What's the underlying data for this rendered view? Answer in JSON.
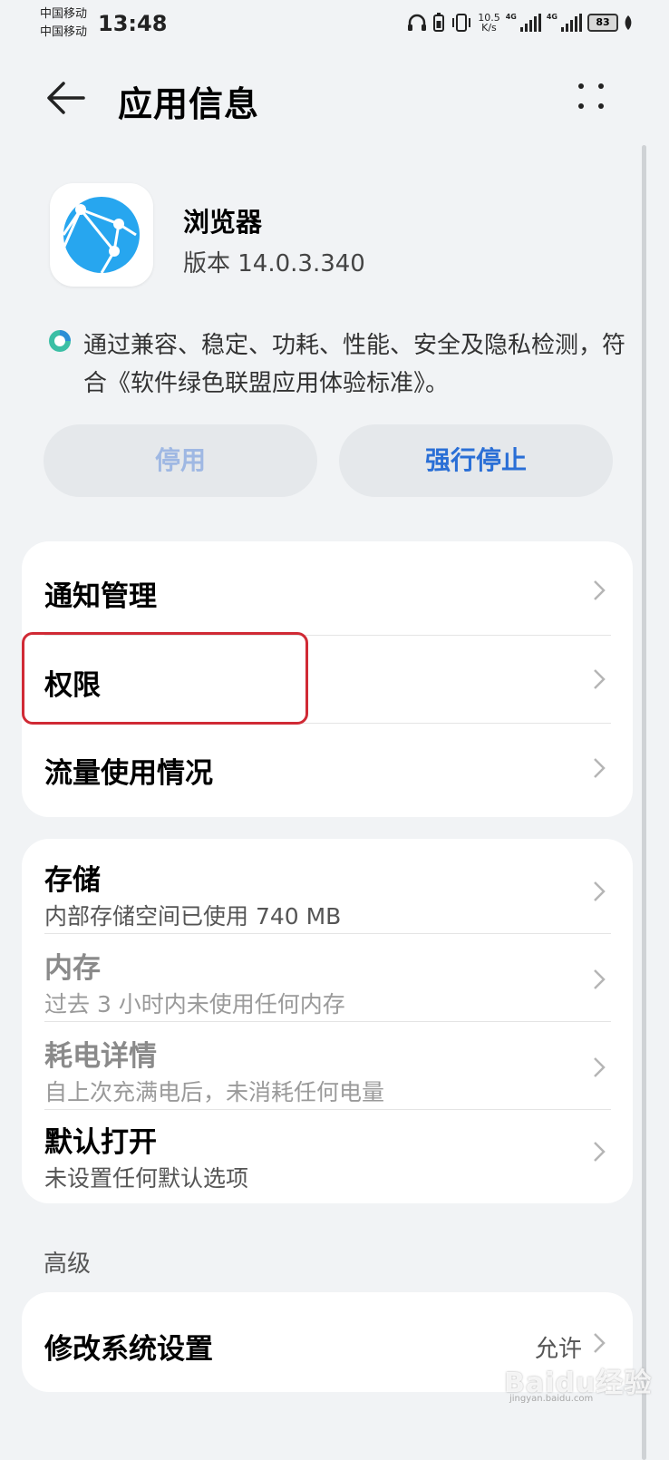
{
  "status_bar": {
    "carrier_1": "中国移动",
    "carrier_2": "中国移动",
    "time": "13:48",
    "speed_value": "10.5",
    "speed_unit": "K/s",
    "network_1": "4G",
    "network_2": "4G",
    "battery": "83"
  },
  "header": {
    "title": "应用信息"
  },
  "app": {
    "name": "浏览器",
    "version": "版本 14.0.3.340",
    "verification": "通过兼容、稳定、功耗、性能、安全及隐私检测，符合《软件绿色联盟应用体验标准》。"
  },
  "actions": {
    "disable_label": "停用",
    "force_stop_label": "强行停止"
  },
  "settings_group_1": [
    {
      "label": "通知管理"
    },
    {
      "label": "权限"
    },
    {
      "label": "流量使用情况"
    }
  ],
  "settings_group_2": [
    {
      "label": "存储",
      "sub": "内部存储空间已使用 740 MB"
    },
    {
      "label": "内存",
      "sub": "过去 3 小时内未使用任何内存"
    },
    {
      "label": "耗电详情",
      "sub": "自上次充满电后，未消耗任何电量"
    },
    {
      "label": "默认打开",
      "sub": "未设置任何默认选项"
    }
  ],
  "advanced": {
    "section_title": "高级",
    "items": [
      {
        "label": "修改系统设置",
        "value": "允许"
      }
    ]
  },
  "watermark": {
    "text": "Baidu经验",
    "sub": "jingyan.baidu.com"
  },
  "colors": {
    "accent": "#2a6fd6",
    "highlight_border": "#d02a35",
    "background": "#f1f3f5"
  }
}
